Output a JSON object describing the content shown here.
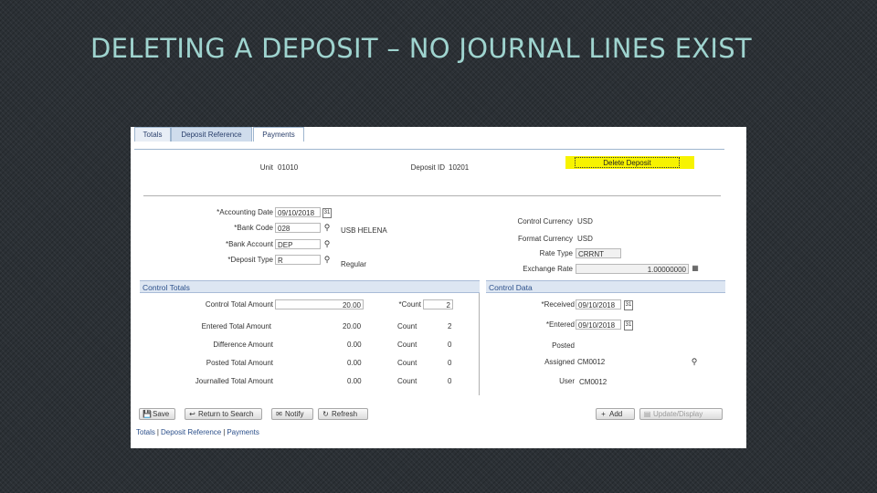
{
  "slide": {
    "title": "DELETING A DEPOSIT – NO JOURNAL LINES EXIST"
  },
  "tabs": [
    "Totals",
    "Deposit Reference",
    "Payments"
  ],
  "header": {
    "unit_label": "Unit",
    "unit_value": "01010",
    "deposit_id_label": "Deposit ID",
    "deposit_id_value": "10201",
    "delete_button": "Delete Deposit"
  },
  "form": {
    "accounting_date_label": "*Accounting Date",
    "accounting_date_value": "09/10/2018",
    "bank_code_label": "*Bank Code",
    "bank_code_value": "028",
    "bank_name": "USB HELENA",
    "bank_account_label": "*Bank Account",
    "bank_account_value": "DEP",
    "deposit_type_label": "*Deposit Type",
    "deposit_type_value": "R",
    "deposit_type_desc": "Regular",
    "control_currency_label": "Control Currency",
    "control_currency_value": "USD",
    "format_currency_label": "Format Currency",
    "format_currency_value": "USD",
    "rate_type_label": "Rate Type",
    "rate_type_value": "CRRNT",
    "exchange_rate_label": "Exchange Rate",
    "exchange_rate_value": "1.00000000"
  },
  "control_totals": {
    "title": "Control Totals",
    "rows": [
      {
        "label": "Control Total Amount",
        "amount": "20.00",
        "count_label": "*Count",
        "count": "2"
      },
      {
        "label": "Entered Total Amount",
        "amount": "20.00",
        "count_label": "Count",
        "count": "2"
      },
      {
        "label": "Difference Amount",
        "amount": "0.00",
        "count_label": "Count",
        "count": "0"
      },
      {
        "label": "Posted Total Amount",
        "amount": "0.00",
        "count_label": "Count",
        "count": "0"
      },
      {
        "label": "Journalled Total Amount",
        "amount": "0.00",
        "count_label": "Count",
        "count": "0"
      }
    ]
  },
  "control_data": {
    "title": "Control Data",
    "received_label": "*Received",
    "received_value": "09/10/2018",
    "entered_label": "*Entered",
    "entered_value": "09/10/2018",
    "posted_label": "Posted",
    "assigned_label": "Assigned",
    "assigned_value": "CM0012",
    "user_label": "User",
    "user_value": "CM0012"
  },
  "toolbar": {
    "save": "Save",
    "return_to_search": "Return to Search",
    "notify": "Notify",
    "refresh": "Refresh",
    "add": "Add",
    "update_display": "Update/Display"
  },
  "footer_links": [
    "Totals",
    "Deposit Reference",
    "Payments"
  ]
}
